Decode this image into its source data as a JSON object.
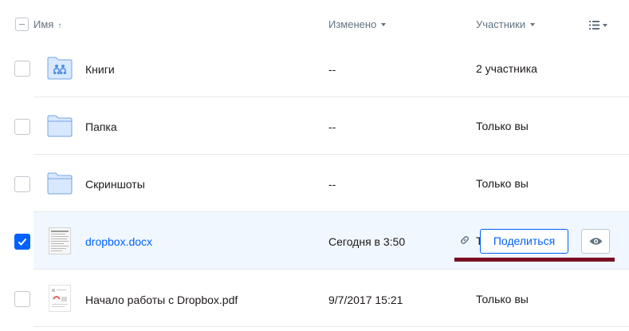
{
  "header": {
    "name_label": "Имя",
    "name_sort_arrow": "↑",
    "modified_label": "Изменено",
    "members_label": "Участники"
  },
  "rows": [
    {
      "name": "Книги",
      "modified": "--",
      "members": "2 участника",
      "icon": "shared-folder-icon",
      "selected": false
    },
    {
      "name": "Папка",
      "modified": "--",
      "members": "Только вы",
      "icon": "folder-icon",
      "selected": false
    },
    {
      "name": "Скриншоты",
      "modified": "--",
      "members": "Только вы",
      "icon": "folder-icon",
      "selected": false
    },
    {
      "name": "dropbox.docx",
      "modified": "Сегодня в 3:50",
      "members": "Т",
      "icon": "docx-thumbnail-icon",
      "selected": true,
      "share_label": "Поделиться"
    },
    {
      "name": "Начало работы с Dropbox.pdf",
      "modified": "9/7/2017 15:21",
      "members": "Только вы",
      "icon": "pdf-thumbnail-icon",
      "selected": false
    }
  ],
  "colors": {
    "accent": "#0061fe",
    "selected_row_bg": "#f0f7ff",
    "folder_fill": "#d8e8ff",
    "folder_stroke": "#72a6e6",
    "underline_bar": "#7a0f24"
  }
}
